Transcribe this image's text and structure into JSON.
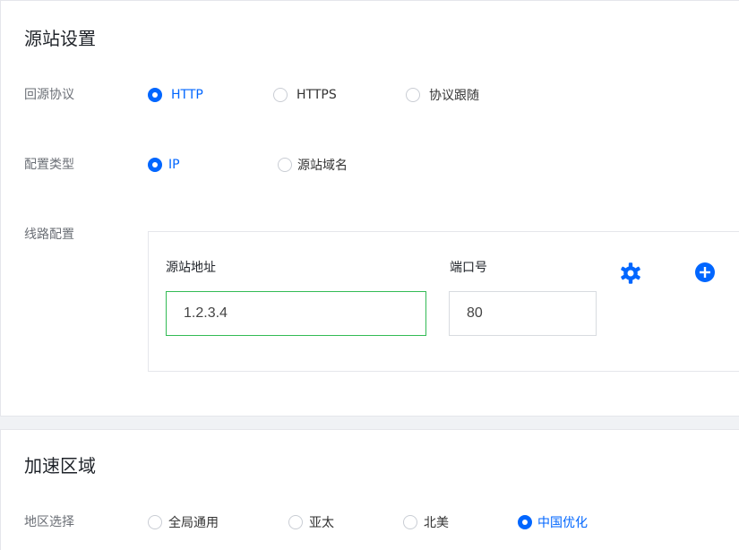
{
  "origin_settings": {
    "title": "源站设置",
    "protocol": {
      "label": "回源协议",
      "options": [
        {
          "label": "HTTP",
          "selected": true
        },
        {
          "label": "HTTPS",
          "selected": false
        },
        {
          "label": "协议跟随",
          "selected": false
        }
      ]
    },
    "config_type": {
      "label": "配置类型",
      "options": [
        {
          "label": "IP",
          "selected": true
        },
        {
          "label": "源站域名",
          "selected": false
        }
      ]
    },
    "route_config": {
      "label": "线路配置",
      "address_label": "源站地址",
      "address_value": "1.2.3.4",
      "port_label": "端口号",
      "port_value": "80",
      "settings_icon": "gear-icon",
      "add_icon": "plus-circle-icon"
    }
  },
  "acceleration_region": {
    "title": "加速区域",
    "region": {
      "label": "地区选择",
      "options": [
        {
          "label": "全局通用",
          "selected": false
        },
        {
          "label": "亚太",
          "selected": false
        },
        {
          "label": "北美",
          "selected": false
        },
        {
          "label": "中国优化",
          "selected": true
        }
      ]
    }
  },
  "colors": {
    "accent": "#0066ff",
    "input_valid_border": "#33bb55",
    "page_background": "#f0f2f5"
  }
}
